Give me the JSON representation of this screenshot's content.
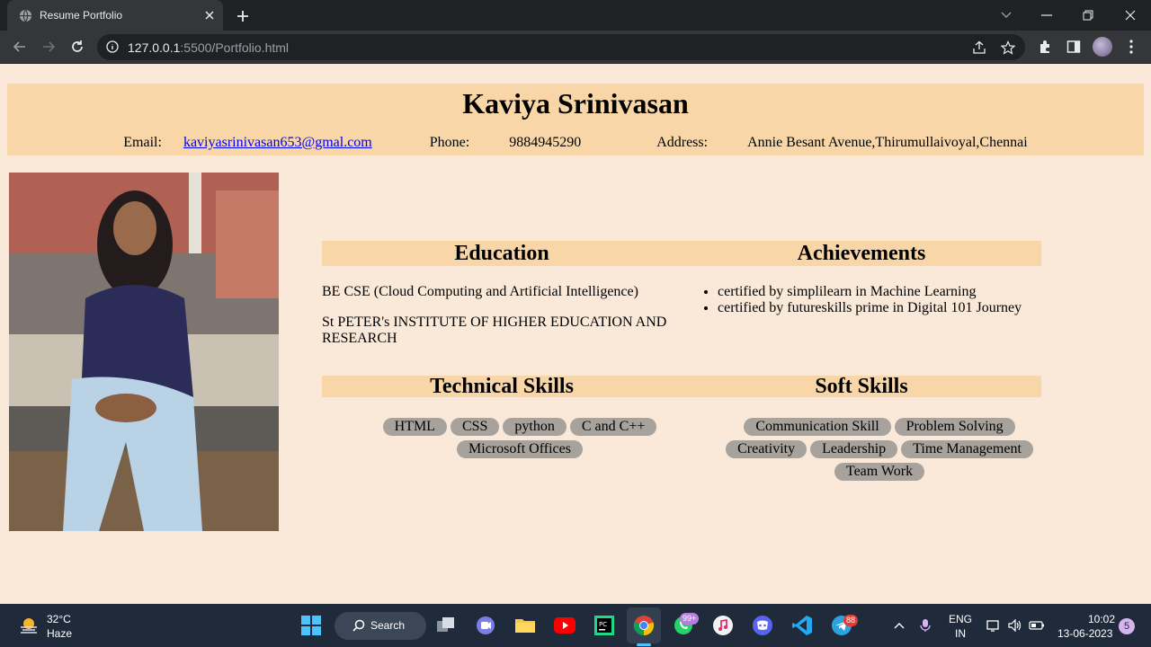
{
  "browser": {
    "tab_title": "Resume Portfolio",
    "url_host": "127.0.0.1",
    "url_path": ":5500/Portfolio.html"
  },
  "header": {
    "name": "Kaviya Srinivasan",
    "email_label": "Email:",
    "email": "kaviyasrinivasan653@gmal.com",
    "phone_label": "Phone:",
    "phone": "9884945290",
    "address_label": "Address:",
    "address": "Annie Besant Avenue,Thirumullaivoyal,Chennai"
  },
  "education": {
    "title": "Education",
    "degree": "BE CSE (Cloud Computing and Artificial Intelligence)",
    "college": "St PETER's INSTITUTE OF HIGHER EDUCATION AND RESEARCH"
  },
  "achievements": {
    "title": "Achievements",
    "items": [
      "certified by simplilearn in Machine Learning",
      "certified by futureskills prime in Digital 101 Journey"
    ]
  },
  "technical_skills": {
    "title": "Technical Skills",
    "items": [
      "HTML",
      "CSS",
      "python",
      "C and C++",
      "Microsoft Offices"
    ]
  },
  "soft_skills": {
    "title": "Soft Skills",
    "items": [
      "Communication Skill",
      "Problem Solving",
      "Creativity",
      "Leadership",
      "Time Management",
      "Team Work"
    ]
  },
  "taskbar": {
    "temperature": "32°C",
    "condition": "Haze",
    "search_label": "Search",
    "whatsapp_badge": "99+",
    "telegram_badge": "88",
    "lang_top": "ENG",
    "lang_bottom": "IN",
    "time": "10:02",
    "date": "13-06-2023",
    "notifications": "5"
  },
  "colors": {
    "page_bg": "#fae9d8",
    "header_bg": "#f8d6a8",
    "pill_bg": "#a8a29c",
    "taskbar_bg": "#1f2b3a"
  }
}
